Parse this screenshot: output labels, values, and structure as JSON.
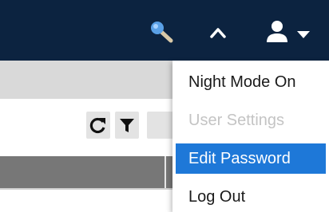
{
  "topbar": {
    "icons": [
      "magic-wand-icon",
      "chevron-up-icon",
      "user-icon",
      "caret-down-icon"
    ],
    "background": "#0c2340"
  },
  "toolbar": {
    "icons": [
      "refresh-icon",
      "filter-icon"
    ]
  },
  "user_menu": {
    "items": [
      {
        "label": "Night Mode On",
        "state": "enabled"
      },
      {
        "label": "User Settings",
        "state": "disabled"
      },
      {
        "label": "Edit Password",
        "state": "highlighted"
      },
      {
        "label": "Log Out",
        "state": "enabled"
      }
    ],
    "highlight_color": "#1e78d8",
    "disabled_color": "#c4c4c4"
  }
}
